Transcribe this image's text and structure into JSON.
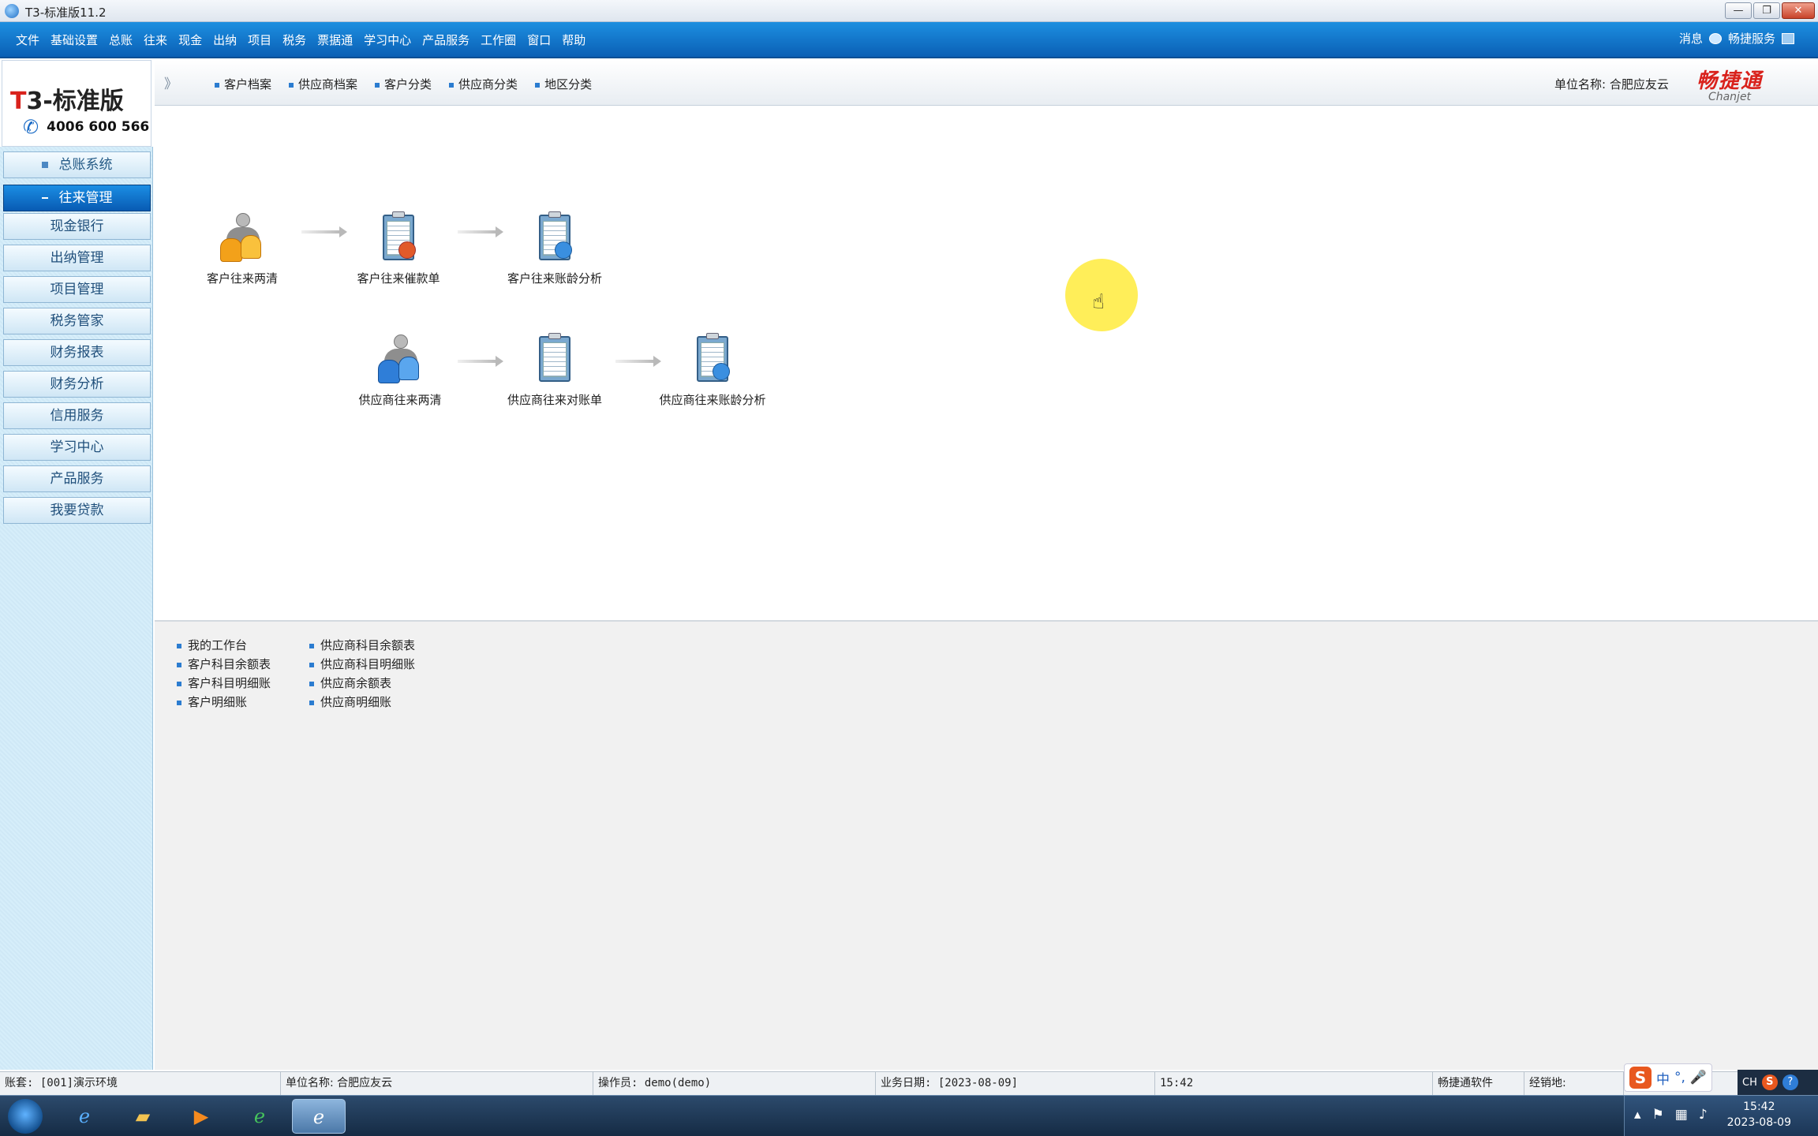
{
  "window": {
    "title": "T3-标准版11.2",
    "min_label": "—",
    "max_label": "❐",
    "close_label": "✕"
  },
  "menu": {
    "items": [
      "文件",
      "基础设置",
      "总账",
      "往来",
      "现金",
      "出纳",
      "项目",
      "税务",
      "票据通",
      "学习中心",
      "产品服务",
      "工作圈",
      "窗口",
      "帮助"
    ],
    "right": {
      "messages": "消息",
      "service": "畅捷服务"
    }
  },
  "logo": {
    "brand_t": "T",
    "brand_rest": "3-标准版",
    "phone": "4006 600 566"
  },
  "sidebar": {
    "groups": [
      {
        "label": "总账系统",
        "active": false
      },
      {
        "label": "往来管理",
        "active": true
      }
    ],
    "items": [
      "现金银行",
      "出纳管理",
      "项目管理",
      "税务管家",
      "财务报表",
      "财务分析",
      "信用服务",
      "学习中心",
      "产品服务",
      "我要贷款"
    ]
  },
  "toolbar": {
    "chevron": "》",
    "links": [
      "客户档案",
      "供应商档案",
      "客户分类",
      "供应商分类",
      "地区分类"
    ],
    "unit_label": "单位名称:",
    "unit_value": "合肥应友云",
    "chanjet_cn": "畅捷通",
    "chanjet_en": "Chanjet"
  },
  "flow": {
    "row1": [
      "客户往来两清",
      "客户往来催款单",
      "客户往来账龄分析"
    ],
    "row2": [
      "供应商往来两清",
      "供应商往来对账单",
      "供应商往来账龄分析"
    ]
  },
  "links_panel": {
    "col1": [
      "我的工作台",
      "客户科目余额表",
      "客户科目明细账",
      "客户明细账"
    ],
    "col2": [
      "供应商科目余额表",
      "供应商科目明细账",
      "供应商余额表",
      "供应商明细账"
    ]
  },
  "statusbar": {
    "account": "账套: [001]演示环境",
    "unit": "单位名称: 合肥应友云",
    "operator": "操作员: demo(demo)",
    "biz_date": "业务日期: [2023-08-09]",
    "time": "15:42",
    "software": "畅捷通软件",
    "dealer": "经销地:"
  },
  "ime": {
    "s": "S",
    "cn": "中",
    "punct": "°,",
    "mic": "🎤"
  },
  "taskbar": {
    "tray_ch": "CH",
    "clock_time": "15:42",
    "clock_date": "2023-08-09"
  }
}
